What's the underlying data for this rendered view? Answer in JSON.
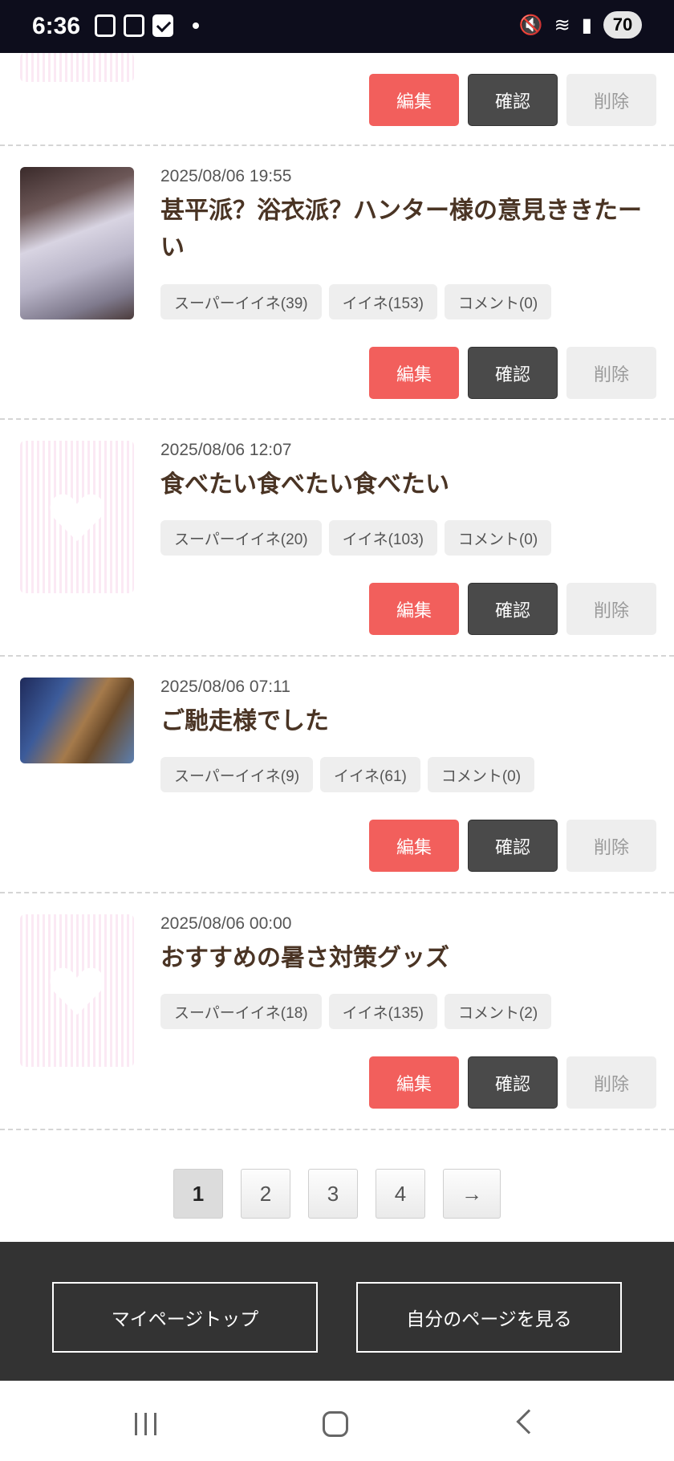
{
  "status_bar": {
    "time": "6:36",
    "battery": "70"
  },
  "buttons": {
    "edit": "編集",
    "confirm": "確認",
    "delete": "削除"
  },
  "posts": [
    {
      "date": "2025/08/06 19:55",
      "title": "甚平派？浴衣派？ハンター様の意見ききたーい",
      "tags": [
        "スーパーイイネ(39)",
        "イイネ(153)",
        "コメント(0)"
      ],
      "thumbnail": "photo"
    },
    {
      "date": "2025/08/06 12:07",
      "title": "食べたい食べたい食べたい",
      "tags": [
        "スーパーイイネ(20)",
        "イイネ(103)",
        "コメント(0)"
      ],
      "thumbnail": "heart-placeholder"
    },
    {
      "date": "2025/08/06 07:11",
      "title": "ご馳走様でした",
      "tags": [
        "スーパーイイネ(9)",
        "イイネ(61)",
        "コメント(0)"
      ],
      "thumbnail": "photo"
    },
    {
      "date": "2025/08/06 00:00",
      "title": "おすすめの暑さ対策グッズ",
      "tags": [
        "スーパーイイネ(18)",
        "イイネ(135)",
        "コメント(2)"
      ],
      "thumbnail": "heart-placeholder"
    }
  ],
  "pagination": {
    "pages": [
      "1",
      "2",
      "3",
      "4"
    ],
    "next": "→",
    "current": "1"
  },
  "footer": {
    "mypage_top": "マイページトップ",
    "view_my_page": "自分のページを見る"
  }
}
